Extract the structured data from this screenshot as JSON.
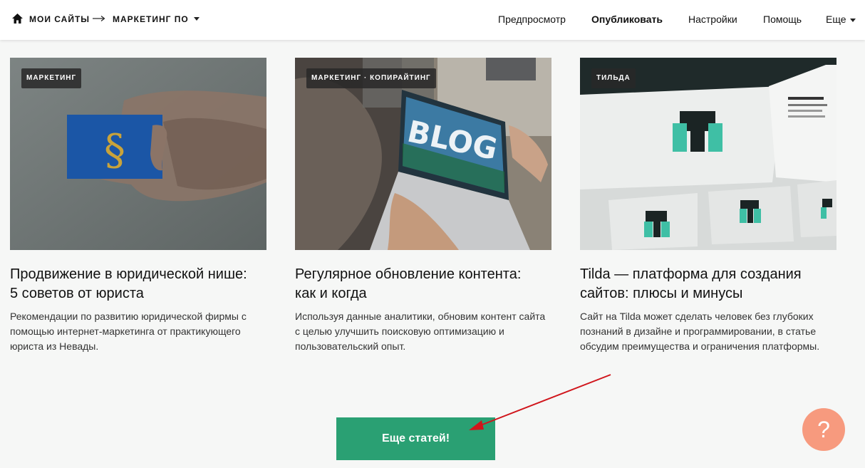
{
  "header": {
    "breadcrumb": {
      "root": "МОИ САЙТЫ",
      "current": "МАРКЕТИНГ ПО"
    },
    "nav": {
      "preview": "Предпросмотр",
      "publish": "Опубликовать",
      "settings": "Настройки",
      "help": "Помощь",
      "more": "Еще"
    }
  },
  "cards": [
    {
      "tag": "МАРКЕТИНГ",
      "title": "Продвижение в юридической нише: 5 советов от юриста",
      "description": "Рекомендации по развитию юридической фирмы с помощью интернет-маркетинга от практикующего юриста из Невады."
    },
    {
      "tag": "МАРКЕТИНГ · КОПИРАЙТИНГ",
      "image_text": "BLOG",
      "title": "Регулярное обновление контента: как и когда",
      "description": "Используя данные аналитики, обновим контент сайта с целью улучшить поисковую оптимизацию и пользовательский опыт."
    },
    {
      "tag": "ТИЛЬДА",
      "title": "Tilda — платформа для создания сайтов: плюсы и минусы",
      "description": "Сайт на Tilda может сделать человек без глубоких познаний в дизайне и программировании, в статье обсудим преимущества и ограничения платформы."
    }
  ],
  "more_button": "Еще статей!",
  "help_bubble": "?",
  "colors": {
    "button": "#2aa073",
    "help_bubble": "#f79a7e",
    "annotation_arrow": "#d0151b"
  }
}
